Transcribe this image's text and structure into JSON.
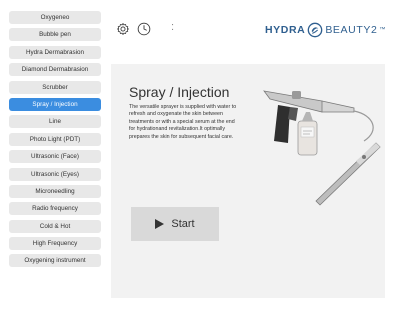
{
  "sidebar": {
    "items": [
      {
        "label": "Oxygeneo",
        "active": false
      },
      {
        "label": "Bubble pen",
        "active": false
      },
      {
        "label": "Hydra Dermabrasion",
        "active": false
      },
      {
        "label": "Diamond Dermabrasion",
        "active": false
      },
      {
        "label": "Scrubber",
        "active": false
      },
      {
        "label": "Spray / Injection",
        "active": true
      },
      {
        "label": "Line",
        "active": false
      },
      {
        "label": "Photo Light (PDT)",
        "active": false
      },
      {
        "label": "Ultrasonic (Face)",
        "active": false
      },
      {
        "label": "Ultrasonic (Eyes)",
        "active": false
      },
      {
        "label": "Microneedling",
        "active": false
      },
      {
        "label": "Radio frequency",
        "active": false
      },
      {
        "label": "Cold & Hot",
        "active": false
      },
      {
        "label": "High Frequency",
        "active": false
      },
      {
        "label": "Oxygening instrument",
        "active": false
      }
    ]
  },
  "header": {
    "menu_glyph": ":",
    "brand": {
      "main": "HYDRA",
      "sub": "BEAUTY2",
      "sup": "™"
    }
  },
  "main": {
    "title": "Spray / Injection",
    "description": "The versatile sprayer is supplied with water to refresh and oxygenate the skin between treatments or with a special serum at the end for hydrationand revitalization.It optimally prepares the skin for subsequent facial care.",
    "start_label": "Start"
  },
  "colors": {
    "accent": "#3b8de0",
    "brand": "#2f5f8f"
  },
  "icons": [
    "gear-icon",
    "clock-icon",
    "brand-logo-icon",
    "play-icon"
  ]
}
